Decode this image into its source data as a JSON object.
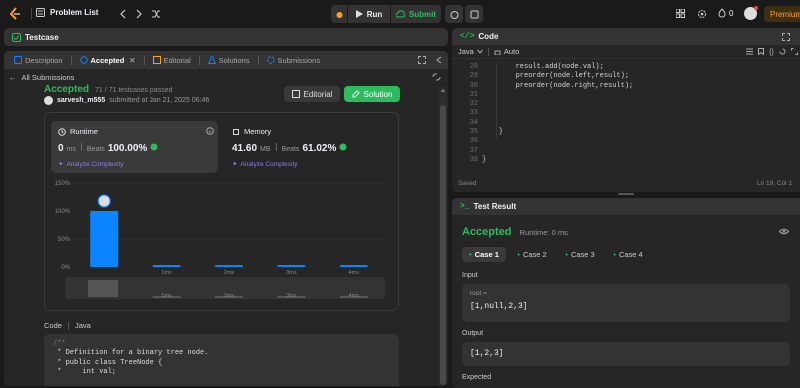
{
  "topbar": {
    "problem_list": "Problem List",
    "run": "Run",
    "submit": "Submit",
    "streak": "0",
    "premium": "Premium"
  },
  "testcase_bar": {
    "title": "Testcase"
  },
  "left_tabs": [
    "Description",
    "Accepted",
    "Editorial",
    "Solutions",
    "Submissions"
  ],
  "all_submissions": "All Submissions",
  "submission": {
    "status": "Accepted",
    "passed": "71 / 71 testcases passed",
    "user": "sarvesh_m555",
    "submitted_at": "submitted at Jan 21, 2025 06:46",
    "editorial_btn": "Editorial",
    "solution_btn": "Solution"
  },
  "runtime": {
    "label": "Runtime",
    "value": "0",
    "unit": "ms",
    "beats_label": "Beats",
    "beats": "100.00%",
    "analyze": "Analyze Complexity"
  },
  "memory": {
    "label": "Memory",
    "value": "41.60",
    "unit": "MB",
    "beats_label": "Beats",
    "beats": "61.02%",
    "analyze": "Analyze Complexity"
  },
  "chart_data": {
    "type": "bar",
    "categories": [
      "0ms",
      "1ms",
      "2ms",
      "3ms",
      "4ms"
    ],
    "tick_labels": [
      "",
      "1ms",
      "2ms",
      "3ms",
      "4ms"
    ],
    "values": [
      100,
      1,
      1,
      1,
      1
    ],
    "ylim": [
      0,
      150
    ],
    "yticks": [
      "150%",
      "100%",
      "50%",
      "0%"
    ],
    "mini_labels": [
      "1ms",
      "2ms",
      "3ms",
      "4ms"
    ],
    "bar_color": "#0a84ff"
  },
  "code_section": {
    "label": "Code",
    "lang": "Java",
    "lines": [
      "/**",
      " * Definition for a binary tree node.",
      " * public class TreeNode {",
      " *     int val;"
    ]
  },
  "editor": {
    "title": "Code",
    "lang": "Java",
    "mode": "Auto",
    "line_numbers": [
      "28",
      "29",
      "30",
      "31",
      "32",
      "33",
      "34",
      "35",
      "36",
      "37",
      "38"
    ],
    "lines": [
      "        result.add(node.val);",
      "        preorder(node.left,result);",
      "        preorder(node.right,result);",
      "",
      "",
      "",
      "",
      "    }",
      "",
      "",
      "}"
    ],
    "saved": "Saved",
    "cursor": "Ln 19, Col 1"
  },
  "test_result": {
    "title": "Test Result",
    "status": "Accepted",
    "runtime": "Runtime: 0 ms",
    "cases": [
      "Case 1",
      "Case 2",
      "Case 3",
      "Case 4"
    ],
    "input_label": "Input",
    "param_name": "root =",
    "param_value": "[1,null,2,3]",
    "output_label": "Output",
    "output_value": "[1,2,3]",
    "expected_label": "Expected"
  },
  "colors": {
    "accent": "#2cbb5d",
    "brand": "#ffa116",
    "bar": "#0a84ff"
  }
}
